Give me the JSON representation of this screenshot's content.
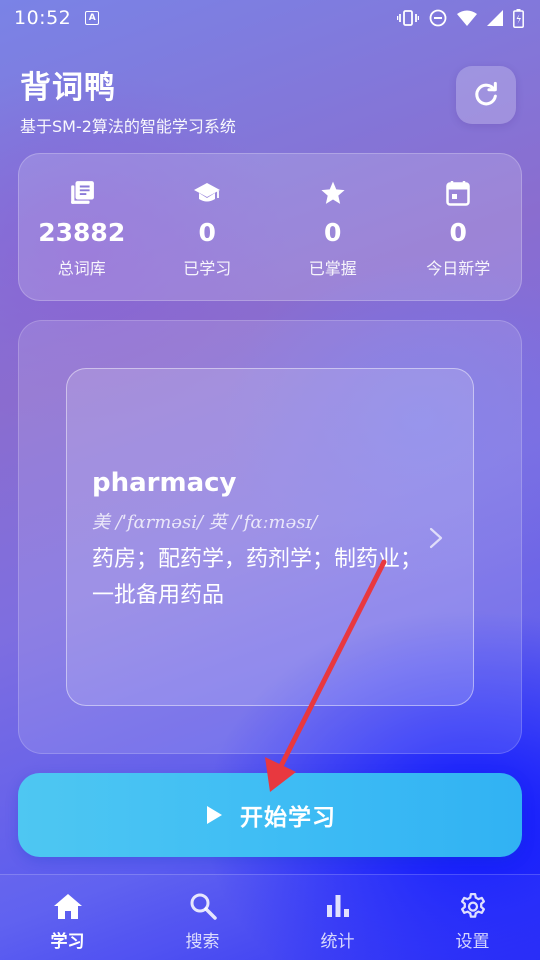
{
  "status_bar": {
    "time": "10:52",
    "notification_badge": "A"
  },
  "header": {
    "title": "背词鸭",
    "subtitle": "基于SM-2算法的智能学习系统",
    "refresh_icon": "refresh-icon"
  },
  "stats": [
    {
      "icon": "book-icon",
      "value": "23882",
      "label": "总词库"
    },
    {
      "icon": "graduation-cap-icon",
      "value": "0",
      "label": "已学习"
    },
    {
      "icon": "star-icon",
      "value": "0",
      "label": "已掌握"
    },
    {
      "icon": "calendar-icon",
      "value": "0",
      "label": "今日新学"
    }
  ],
  "word_card": {
    "word": "pharmacy",
    "phonetic": "美 /ˈfɑrməsi/   英 /ˈfɑːməsɪ/",
    "meaning": "药房；配药学，药剂学；制药业；一批备用药品"
  },
  "start_button": {
    "label": "开始学习",
    "icon": "play-icon"
  },
  "nav": [
    {
      "icon": "home-icon",
      "label": "学习",
      "active": true
    },
    {
      "icon": "search-icon",
      "label": "搜索",
      "active": false
    },
    {
      "icon": "bar-chart-icon",
      "label": "统计",
      "active": false
    },
    {
      "icon": "gear-icon",
      "label": "设置",
      "active": false
    }
  ],
  "colors": {
    "start_button": "#3fbdf4",
    "annotation_arrow": "#e8383f"
  }
}
